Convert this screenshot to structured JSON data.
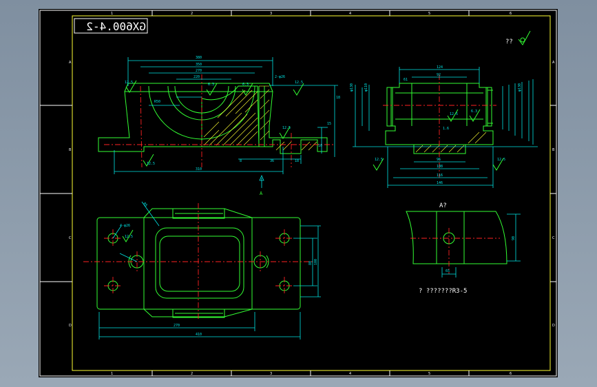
{
  "drawing": {
    "title_mirrored": "GX600.4-2",
    "section_label": "A?",
    "arrow_label": "A",
    "note": "? ???????R3-5",
    "roughness_symbol": "??",
    "zone_cols": [
      "1",
      "2",
      "3",
      "4",
      "5",
      "6"
    ],
    "zone_rows": [
      "A",
      "B",
      "C",
      "D"
    ],
    "dims_front": [
      "380",
      "350",
      "270",
      "220",
      "2-ψ26",
      "12.5",
      "12.5",
      "6.3",
      "6.3",
      "12.5",
      "12.5",
      "310",
      "R50",
      "15",
      "8",
      "36",
      "18",
      "10",
      "18"
    ],
    "dims_side": [
      "124",
      "92",
      "61",
      "φ130",
      "φ110",
      "φ130",
      "12.5",
      "6.3",
      "1.6",
      "96",
      "108",
      "116",
      "146",
      "12.5",
      "12.5"
    ],
    "dims_top": [
      "4-ψ26",
      "R5",
      "12.5",
      "80",
      "100",
      "270",
      "410"
    ],
    "dims_section": [
      "90",
      "65"
    ],
    "colors": {
      "frame": "#ffff33",
      "outline": "#33ff33",
      "dimension": "#00e5e5",
      "centerline": "#ff2222",
      "background": "#000000"
    }
  }
}
